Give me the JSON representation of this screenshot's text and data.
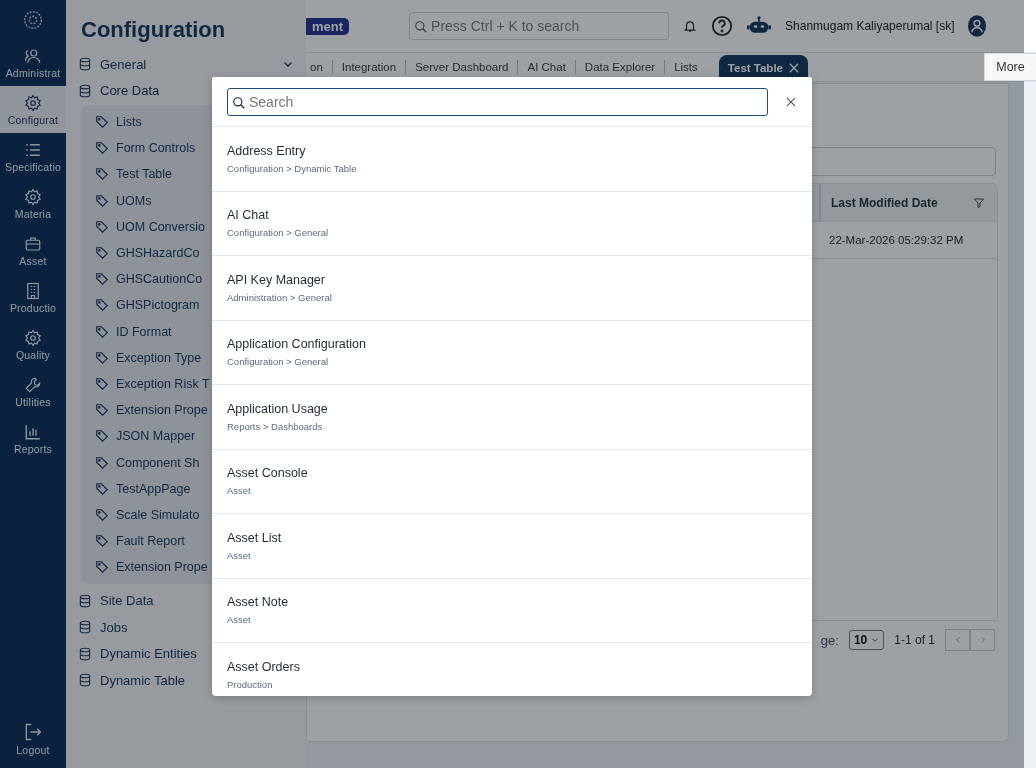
{
  "rail": {
    "items": [
      {
        "label": "Administrat",
        "selected": false
      },
      {
        "label": "Configurat",
        "selected": true
      },
      {
        "label": "Specificatio",
        "selected": false
      },
      {
        "label": "Materia",
        "selected": false
      },
      {
        "label": "Asset",
        "selected": false
      },
      {
        "label": "Productio",
        "selected": false
      },
      {
        "label": "Quality",
        "selected": false
      },
      {
        "label": "Utilities",
        "selected": false
      },
      {
        "label": "Reports",
        "selected": false
      }
    ],
    "logout": "Logout"
  },
  "config_panel": {
    "title": "Configuration",
    "groups": [
      {
        "label": "General",
        "expanded": false
      },
      {
        "label": "Core Data",
        "expanded": true,
        "children": [
          "Lists",
          "Form Controls",
          "Test Table",
          "UOMs",
          "UOM Conversio",
          "GHSHazardCo",
          "GHSCautionCo",
          "GHSPictogram",
          "ID Format",
          "Exception Type",
          "Exception Risk T",
          "Extension Prope",
          "JSON Mapper",
          "Component Sh",
          "TestAppPage",
          "Scale Simulato",
          "Fault Report",
          "Extension Prope"
        ]
      },
      {
        "label": "Site Data",
        "expanded": false
      },
      {
        "label": "Jobs",
        "expanded": false
      },
      {
        "label": "Dynamic Entities",
        "expanded": false
      },
      {
        "label": "Dynamic Table",
        "expanded": false
      }
    ]
  },
  "header": {
    "badge": "ment",
    "search_placeholder": "Press Ctrl + K to search",
    "user": "Shanmugam Kaliyaperumal [sk]"
  },
  "tabs": [
    {
      "label": "on",
      "selected": false
    },
    {
      "label": "Integration",
      "selected": false
    },
    {
      "label": "Server Dashboard",
      "selected": false
    },
    {
      "label": "AI Chat",
      "selected": false
    },
    {
      "label": "Data Explorer",
      "selected": false
    },
    {
      "label": "Lists",
      "selected": false
    },
    {
      "label": "Test Table",
      "selected": true
    }
  ],
  "more_button": "More",
  "table": {
    "column": "Last Modified Date",
    "rows": [
      "22-Mar-2026 05:29:32 PM"
    ]
  },
  "pagination": {
    "label": "ge:",
    "page_size": "10",
    "range": "1-1 of 1"
  },
  "search_dialog": {
    "placeholder": "Search",
    "results": [
      {
        "title": "Address Entry",
        "path": "Configuration > Dynamic Table"
      },
      {
        "title": "AI Chat",
        "path": "Configuration > General"
      },
      {
        "title": "API Key Manager",
        "path": "Administration > General"
      },
      {
        "title": "Application Configuration",
        "path": "Configuration > General"
      },
      {
        "title": "Application Usage",
        "path": "Reports > Dashboards"
      },
      {
        "title": "Asset Console",
        "path": "Asset"
      },
      {
        "title": "Asset List",
        "path": "Asset"
      },
      {
        "title": "Asset Note",
        "path": "Asset"
      },
      {
        "title": "Asset Orders",
        "path": "Production"
      }
    ]
  }
}
